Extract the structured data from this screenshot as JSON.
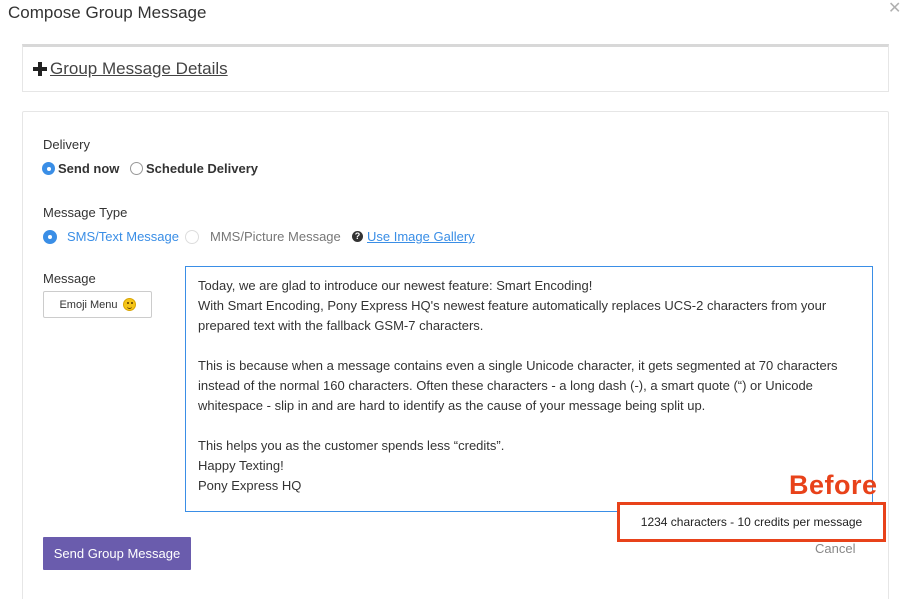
{
  "dialog": {
    "title": "Compose Group Message",
    "close_icon": "close-icon"
  },
  "details_panel": {
    "label": "Group Message Details",
    "icon": "plus-icon"
  },
  "delivery": {
    "label": "Delivery",
    "options": [
      {
        "label": "Send now",
        "selected": true
      },
      {
        "label": "Schedule Delivery",
        "selected": false
      }
    ]
  },
  "message_type": {
    "label": "Message Type",
    "options": [
      {
        "label": "SMS/Text Message",
        "selected": true
      },
      {
        "label": "MMS/Picture Message",
        "selected": false
      }
    ],
    "gallery_link": "Use Image Gallery",
    "help_icon": "question-circle-icon"
  },
  "message": {
    "label": "Message",
    "emoji_button": "Emoji Menu",
    "lines": [
      "Today, we are glad to introduce our newest feature: Smart Encoding!",
      "With Smart Encoding, Pony Express HQ's newest feature automatically replaces UCS-2 characters from your",
      "prepared text with the fallback GSM-7 characters.",
      "",
      "This is because when a message contains even a single Unicode character, it gets segmented at 70 characters",
      "instead of the normal 160 characters. Often these characters - a long dash (-), a smart quote (“) or Unicode",
      "whitespace - slip in and are hard to identify as the cause of your message being split up.",
      "",
      "This helps you as the customer spends less “credits”.",
      "Happy Texting!",
      "Pony Express HQ"
    ]
  },
  "annotation": {
    "label": "Before",
    "color": "#e8421a"
  },
  "counter": {
    "text": "1234 characters - 10 credits per message"
  },
  "actions": {
    "cancel": "Cancel",
    "send": "Send Group Message"
  },
  "colors": {
    "accent": "#3a8ee6",
    "send_button": "#6a5cad"
  }
}
